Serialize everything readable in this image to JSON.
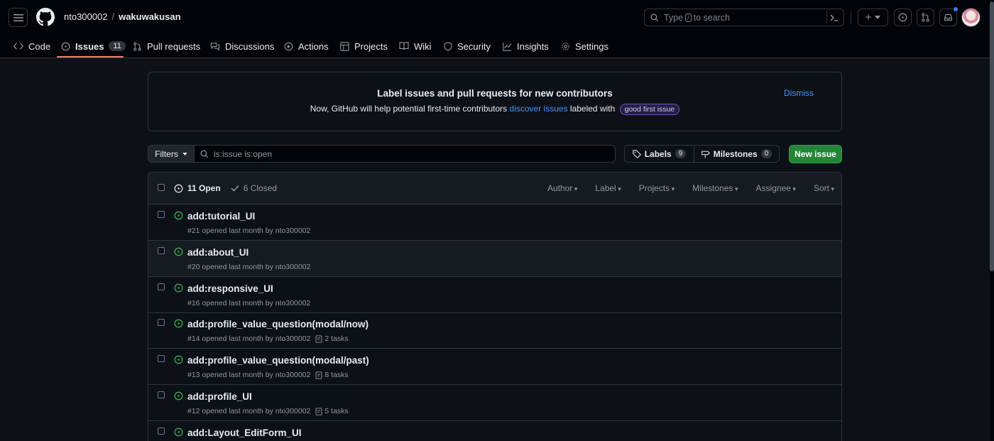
{
  "header": {
    "owner": "nto300002",
    "separator": "/",
    "repo": "wakuwakusan",
    "search_prefix": "Type",
    "search_key": "/",
    "search_suffix": "to search",
    "plus_label": "+"
  },
  "nav": {
    "tabs": [
      {
        "label": "Code"
      },
      {
        "label": "Issues",
        "count": "11"
      },
      {
        "label": "Pull requests"
      },
      {
        "label": "Discussions"
      },
      {
        "label": "Actions"
      },
      {
        "label": "Projects"
      },
      {
        "label": "Wiki"
      },
      {
        "label": "Security"
      },
      {
        "label": "Insights"
      },
      {
        "label": "Settings"
      }
    ]
  },
  "banner": {
    "title": "Label issues and pull requests for new contributors",
    "text_before": "Now, GitHub will help potential first-time contributors",
    "link": "discover issues",
    "text_after": "labeled with",
    "label_chip": "good first issue",
    "dismiss": "Dismiss"
  },
  "toolbar": {
    "filters": "Filters",
    "query": "is:issue is:open",
    "labels": "Labels",
    "labels_count": "9",
    "milestones": "Milestones",
    "milestones_count": "0",
    "new_issue": "New issue"
  },
  "list_header": {
    "open": "11 Open",
    "closed": "6 Closed",
    "sorts": [
      "Author",
      "Label",
      "Projects",
      "Milestones",
      "Assignee",
      "Sort"
    ]
  },
  "issues": [
    {
      "title": "add:tutorial_UI",
      "meta": "#21 opened last month by nto300002",
      "tasks": ""
    },
    {
      "title": "add:about_UI",
      "meta": "#20 opened last month by nto300002",
      "tasks": ""
    },
    {
      "title": "add:responsive_UI",
      "meta": "#16 opened last month by nto300002",
      "tasks": ""
    },
    {
      "title": "add:profile_value_question(modal/now)",
      "meta": "#14 opened last month by nto300002",
      "tasks": "2 tasks"
    },
    {
      "title": "add:profile_value_question(modal/past)",
      "meta": "#13 opened last month by nto300002",
      "tasks": "8 tasks"
    },
    {
      "title": "add:profile_UI",
      "meta": "#12 opened last month by nto300002",
      "tasks": "5 tasks"
    },
    {
      "title": "add:Layout_EditForm_UI",
      "meta": "",
      "tasks": ""
    }
  ],
  "colors": {
    "accent": "#f78166",
    "open_green": "#3fb950",
    "link": "#4493f8",
    "button_green": "#238636"
  }
}
